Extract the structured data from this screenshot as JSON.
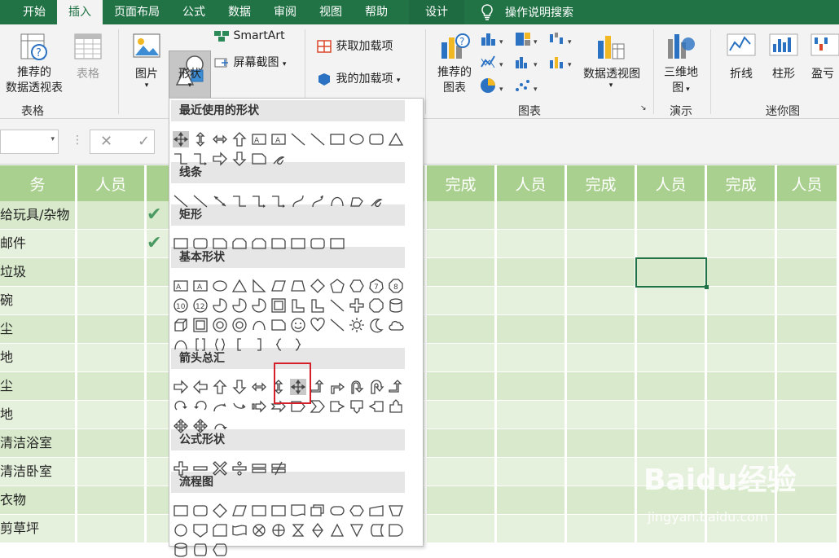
{
  "tabs": [
    "开始",
    "插入",
    "页面布局",
    "公式",
    "数据",
    "审阅",
    "视图",
    "帮助",
    "设计"
  ],
  "tell_me": "操作说明搜索",
  "ribbon": {
    "recommended_pivot": [
      "推荐的",
      "数据透视表"
    ],
    "table": "表格",
    "group_tables": "表格",
    "pictures": "图片",
    "shapes": "形状",
    "smartart": "SmartArt",
    "screenshot": "屏幕截图",
    "get_addins": "获取加载项",
    "my_addins": "我的加载项",
    "recommended_charts": [
      "推荐的",
      "图表"
    ],
    "pivot_chart": "数据透视图",
    "group_charts": "图表",
    "map3d": [
      "三维地",
      "图"
    ],
    "group_demo": "演示",
    "line": "折线",
    "column": "柱形",
    "winloss": "盈亏",
    "group_sparklines": "迷你图"
  },
  "formula_bar": {
    "cancel": "✕",
    "enter": "✓"
  },
  "grid": {
    "headers": [
      "务",
      "人员",
      "完",
      "完成",
      "人员",
      "完成",
      "人员",
      "完成",
      "人员"
    ],
    "rows": [
      "给玩具/杂物",
      "邮件",
      "垃圾",
      "碗",
      "尘",
      "地",
      "尘",
      "地",
      "清洁浴室",
      "清洁卧室",
      "衣物",
      "剪草坪"
    ],
    "checks": [
      true,
      true,
      false,
      false,
      false,
      false,
      false,
      false,
      false,
      false,
      false,
      false
    ]
  },
  "shapes_menu": {
    "sections": [
      "最近使用的形状",
      "线条",
      "矩形",
      "基本形状",
      "箭头总汇",
      "公式形状",
      "流程图"
    ]
  },
  "watermark": {
    "brand": "Baidu经验",
    "url": "jingyan.baidu.com"
  }
}
